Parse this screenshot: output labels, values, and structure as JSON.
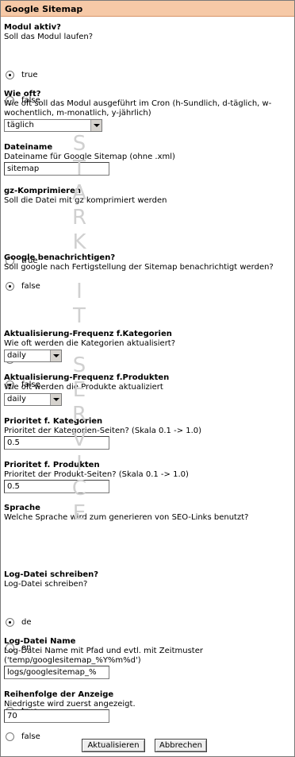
{
  "header": {
    "title": "Google Sitemap"
  },
  "sections": {
    "modul_aktiv": {
      "title": "Modul aktiv?",
      "desc": "Soll das Modul laufen?",
      "options": [
        "true",
        "false"
      ],
      "selected": "true"
    },
    "wie_oft": {
      "title": "Wie oft?",
      "desc": "Wie oft soll das Modul ausgeführt im Cron (h-Sundlich, d-täglich, w-wochentlich, m-monatlich, y-jährlich)",
      "value": "täglich"
    },
    "dateiname": {
      "title": "Dateiname",
      "desc": "Dateiname für Google Sitemap (ohne .xml)",
      "value": "sitemap"
    },
    "gz": {
      "title": "gz-Komprimieren",
      "desc": "Soll die Datei mit gz komprimiert werden",
      "options": [
        "true",
        "false"
      ],
      "selected": "false"
    },
    "benachrichtigen": {
      "title": "Google benachrichtigen?",
      "desc": "Soll google nach Fertigstellung der Sitemap benachrichtigt werden?",
      "options": [
        "true",
        "false"
      ],
      "selected": "false"
    },
    "freq_kat": {
      "title": "Aktualisierung-Frequenz f.Kategorien",
      "desc": "Wie oft werden die Kategorien aktualisiert?",
      "value": "daily"
    },
    "freq_prod": {
      "title": "Aktualisierung-Frequenz f.Produkten",
      "desc": "Wie oft werden die Produkte aktualiziert",
      "value": "daily"
    },
    "prio_kat": {
      "title": "Prioritet f. Kategorien",
      "desc": "Prioritet der Kategorien-Seiten? (Skala 0.1 -> 1.0)",
      "value": "0.5"
    },
    "prio_prod": {
      "title": "Prioritet f. Produkten",
      "desc": "Prioritet der Produkt-Seiten? (Skala 0.1 -> 1.0)",
      "value": "0.5"
    },
    "sprache": {
      "title": "Sprache",
      "desc": "Welche Sprache wird zum generieren von SEO-Links benutzt?",
      "options": [
        "de",
        "en"
      ],
      "selected": "de"
    },
    "log_schreiben": {
      "title": "Log-Datei schreiben?",
      "desc": "Log-Datei schreiben?",
      "options": [
        "true",
        "false"
      ],
      "selected": "true"
    },
    "log_name": {
      "title": "Log-Datei Name",
      "desc": "Log-Datei Name mit Pfad und evtl. mit Zeitmuster ('temp/googlesitemap_%Y%m%d')",
      "value": "logs/googlesitemap_%"
    },
    "reihenfolge": {
      "title": "Reihenfolge der Anzeige",
      "desc": "Niedrigste wird zuerst angezeigt.",
      "value": "70"
    }
  },
  "buttons": {
    "update": "Aktualisieren",
    "cancel": "Abbrechen"
  },
  "watermark": [
    "S",
    "T",
    "A",
    "R",
    "K",
    "",
    "I",
    "T",
    "",
    "S",
    "E",
    "R",
    "V",
    "I",
    "C",
    "E"
  ]
}
